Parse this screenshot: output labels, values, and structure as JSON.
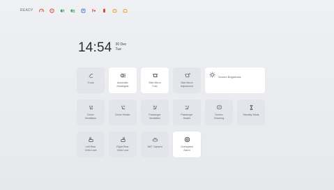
{
  "status_bar": {
    "label": "READY",
    "icons": [
      "speedometer-icon",
      "tire-pressure-icon",
      "headlight-icon",
      "low-beam-icon",
      "seatbelt-icon",
      "airbag-icon",
      "battery-icon",
      "engine-icon",
      "door-open-icon"
    ],
    "colors": [
      "#d9412f",
      "#d9412f",
      "#3aa05a",
      "#3aa05a",
      "#3b6fc9",
      "#d9412f",
      "#d9412f",
      "#e0a21b",
      "#e0a21b"
    ]
  },
  "clock": {
    "time": "14:54",
    "day": "30 Dec",
    "weekday": "Tue"
  },
  "tiles": [
    {
      "id": "trunk",
      "label": "Trunk",
      "icon": "trunk-icon",
      "active": false
    },
    {
      "id": "automatic-headlights",
      "label": "Automatic\nHeadlights",
      "icon": "headlight-icon",
      "active": true
    },
    {
      "id": "side-mirror-fold",
      "label": "Side Mirror\nFold",
      "icon": "mirror-fold-icon",
      "active": true
    },
    {
      "id": "side-mirror-adjustment",
      "label": "Side Mirror\nAdjustment",
      "icon": "mirror-adjust-icon",
      "active": false
    },
    {
      "id": "screen-brightness",
      "label": "Screen Brightness",
      "icon": "sun-icon",
      "active": true,
      "wide": true
    },
    {
      "id": "driver-ventilation",
      "label": "Driver\nVentilation",
      "icon": "seat-vent-icon",
      "active": false
    },
    {
      "id": "driver-heater",
      "label": "Driver Heater",
      "icon": "seat-heat-icon",
      "active": false
    },
    {
      "id": "passenger-ventilation",
      "label": "Passenger\nVentilation",
      "icon": "seat-vent-icon",
      "active": false
    },
    {
      "id": "passenger-heater",
      "label": "Passenger\nHeater",
      "icon": "seat-heat-icon",
      "active": false
    },
    {
      "id": "screen-cleaning",
      "label": "Screen\nCleaning",
      "icon": "screen-clean-icon",
      "active": false
    },
    {
      "id": "standby-mode",
      "label": "Standby Mode",
      "icon": "hourglass-icon",
      "active": false
    },
    {
      "id": "left-rear-child-lock",
      "label": "Left Rear\nChild Lock",
      "icon": "child-lock-icon",
      "active": false
    },
    {
      "id": "right-rear-child-lock",
      "label": "Right Rear\nChild Lock",
      "icon": "child-lock-icon",
      "active": false
    },
    {
      "id": "360-camera",
      "label": "360° Camera",
      "icon": "camera-360-icon",
      "active": false
    },
    {
      "id": "overspeed-alarm",
      "label": "Overspeed\nAlarm",
      "icon": "overspeed-icon",
      "active": true
    }
  ]
}
